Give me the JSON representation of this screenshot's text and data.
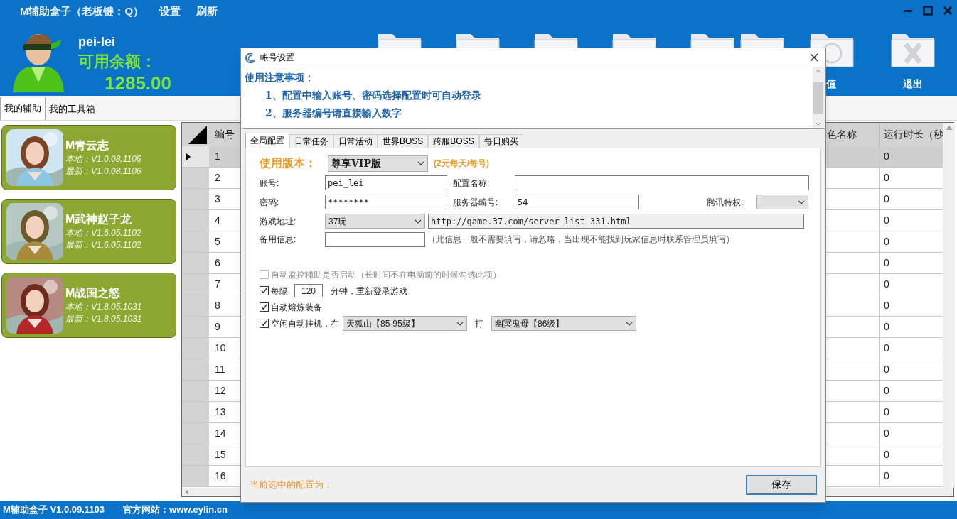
{
  "app": {
    "title": "M辅助盒子（老板键：Q）",
    "menu": [
      "设置",
      "刷新"
    ]
  },
  "user": {
    "name": "pei-lei",
    "balance_label": "可用余额：",
    "balance": "1285.00"
  },
  "toolbar": [
    {
      "label": "值"
    },
    {
      "label": "退出"
    }
  ],
  "tabs": [
    {
      "label": "我的辅助",
      "selected": true
    },
    {
      "label": "我的工具箱",
      "selected": false
    }
  ],
  "games": [
    {
      "name": "M青云志",
      "local": "本地：V1.0.08.1106",
      "latest": "最新：V1.0.08.1106"
    },
    {
      "name": "M武神赵子龙",
      "local": "本地：V1.6.05.1102",
      "latest": "最新：V1.6.05.1102"
    },
    {
      "name": "M战国之怒",
      "local": "本地：V1.8.05.1031",
      "latest": "最新：V1.8.05.1031"
    }
  ],
  "table": {
    "columns": [
      "编号",
      "色名称",
      "运行时长（秒"
    ],
    "rows": [
      {
        "number": "1",
        "runtime": "0",
        "selected": true
      },
      {
        "number": "2",
        "runtime": "0",
        "selected": false
      },
      {
        "number": "3",
        "runtime": "0",
        "selected": false
      },
      {
        "number": "4",
        "runtime": "0",
        "selected": false
      },
      {
        "number": "5",
        "runtime": "0",
        "selected": false
      },
      {
        "number": "6",
        "runtime": "0",
        "selected": false
      },
      {
        "number": "7",
        "runtime": "0",
        "selected": false
      },
      {
        "number": "8",
        "runtime": "0",
        "selected": false
      },
      {
        "number": "9",
        "runtime": "0",
        "selected": false
      },
      {
        "number": "10",
        "runtime": "0",
        "selected": false
      },
      {
        "number": "11",
        "runtime": "0",
        "selected": false
      },
      {
        "number": "12",
        "runtime": "0",
        "selected": false
      },
      {
        "number": "13",
        "runtime": "0",
        "selected": false
      },
      {
        "number": "14",
        "runtime": "0",
        "selected": false
      },
      {
        "number": "15",
        "runtime": "0",
        "selected": false
      },
      {
        "number": "16",
        "runtime": "0",
        "selected": false
      }
    ]
  },
  "status_bar": {
    "product": "M辅助盒子 V1.0.09.1103",
    "website": "官方网站：www.eylin.cn"
  },
  "dialog": {
    "title": "帐号设置",
    "notes": {
      "heading": "使用注意事项：",
      "lines": [
        "1、配置中输入账号、密码选择配置时可自动登录",
        "2、服务器编号请直接输入数字"
      ]
    },
    "tabs": [
      {
        "label": "全局配置",
        "selected": true
      },
      {
        "label": "日常任务",
        "selected": false
      },
      {
        "label": "日常活动",
        "selected": false
      },
      {
        "label": "世界BOSS",
        "selected": false
      },
      {
        "label": "跨服BOSS",
        "selected": false
      },
      {
        "label": "每日购买",
        "selected": false
      }
    ],
    "version": {
      "label": "使用版本：",
      "value": "尊享VIP版",
      "note": "(2元每天/每号)"
    },
    "account": {
      "label": "账号:",
      "value": "pei_lei"
    },
    "config_name": {
      "label": "配置名称:"
    },
    "password": {
      "label": "密码:",
      "value": "********"
    },
    "server": {
      "label": "服务器编号:",
      "value": "54"
    },
    "tencent": {
      "label": "腾讯特权:"
    },
    "game_address": {
      "label": "游戏地址:",
      "platform": "37玩",
      "url": "http://game.37.com/server_list_331.html"
    },
    "backup": {
      "label": "备用信息:",
      "hint": "（此信息一般不需要填写，请忽略，当出现不能找到玩家信息时联系管理员填写）"
    },
    "options": [
      {
        "kind": "plain",
        "label": "自动监控辅助是否启动（长时间不在电脑前的时候勾选此项）",
        "checked": false,
        "disabled": true
      },
      {
        "kind": "interval",
        "label": "每隔",
        "value": "120",
        "suffix": "分钟，重新登录游戏",
        "checked": true,
        "disabled": false
      },
      {
        "kind": "plain",
        "label": "自动熔炼装备",
        "checked": true,
        "disabled": false
      },
      {
        "kind": "idle",
        "label": "空闲自动挂机，在",
        "map": "天狐山【85-95级】",
        "target_label": "打",
        "target": "幽冥鬼母【86级】",
        "checked": true,
        "disabled": false
      }
    ],
    "footer": {
      "current_label": "当前选中的配置为：",
      "save": "保存"
    }
  }
}
